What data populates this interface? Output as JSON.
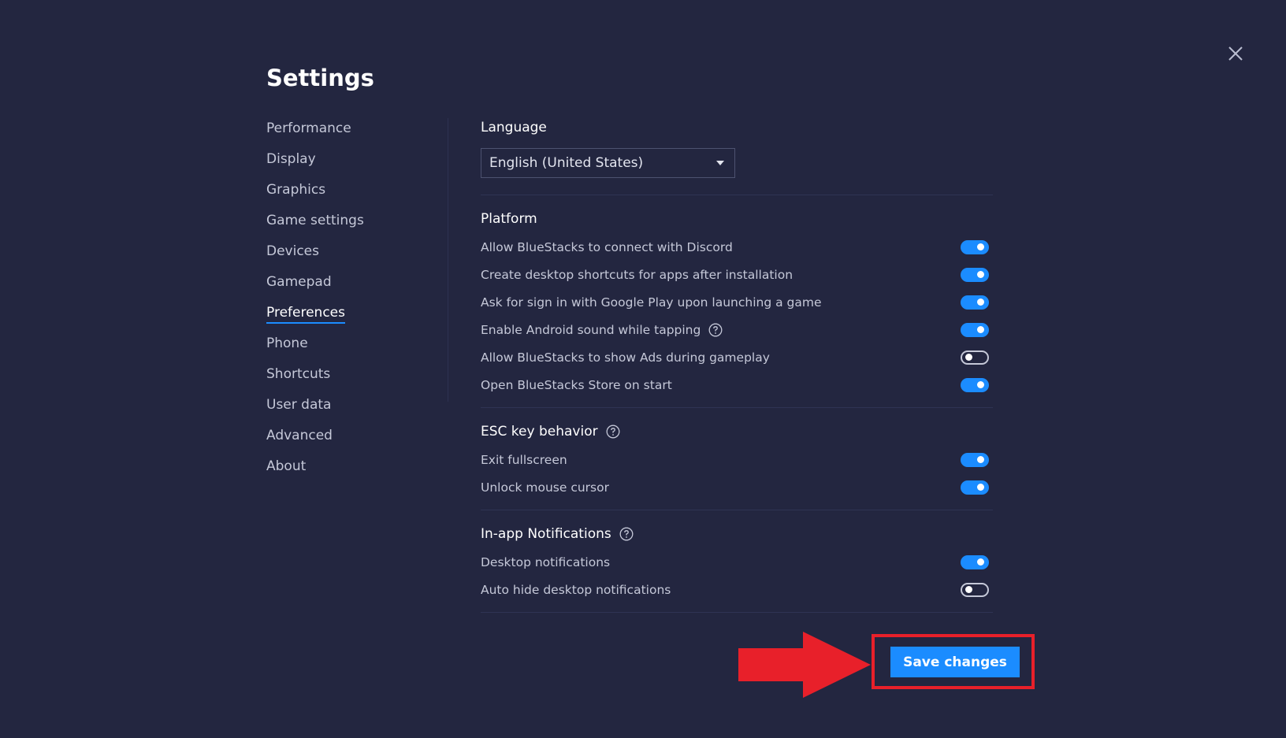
{
  "page": {
    "title": "Settings"
  },
  "sidebar": {
    "items": [
      {
        "label": "Performance",
        "active": false
      },
      {
        "label": "Display",
        "active": false
      },
      {
        "label": "Graphics",
        "active": false
      },
      {
        "label": "Game settings",
        "active": false
      },
      {
        "label": "Devices",
        "active": false
      },
      {
        "label": "Gamepad",
        "active": false
      },
      {
        "label": "Preferences",
        "active": true
      },
      {
        "label": "Phone",
        "active": false
      },
      {
        "label": "Shortcuts",
        "active": false
      },
      {
        "label": "User data",
        "active": false
      },
      {
        "label": "Advanced",
        "active": false
      },
      {
        "label": "About",
        "active": false
      }
    ]
  },
  "language": {
    "title": "Language",
    "selected": "English (United States)"
  },
  "platform": {
    "title": "Platform",
    "items": [
      {
        "label": "Allow BlueStacks to connect with Discord",
        "on": true
      },
      {
        "label": "Create desktop shortcuts for apps after installation",
        "on": true
      },
      {
        "label": "Ask for sign in with Google Play upon launching a game",
        "on": true
      },
      {
        "label": "Enable Android sound while tapping",
        "on": true
      },
      {
        "label": "Allow BlueStacks to show Ads during gameplay",
        "on": false
      },
      {
        "label": "Open BlueStacks Store on start",
        "on": true
      }
    ]
  },
  "esc": {
    "title": "ESC key behavior",
    "items": [
      {
        "label": "Exit fullscreen",
        "on": true
      },
      {
        "label": "Unlock mouse cursor",
        "on": true
      }
    ]
  },
  "notifications": {
    "title": "In-app Notifications",
    "items": [
      {
        "label": "Desktop notifications",
        "on": true
      },
      {
        "label": "Auto hide desktop notifications",
        "on": false
      }
    ]
  },
  "footer": {
    "save_label": "Save changes"
  },
  "icons": {
    "close": "close-icon",
    "help": "help-circle-icon",
    "dropdown": "caret-down-icon",
    "annotation_arrow": "arrow-right-icon"
  },
  "colors": {
    "background": "#232640",
    "accent": "#1b8cff",
    "annotation": "#e8202a"
  }
}
